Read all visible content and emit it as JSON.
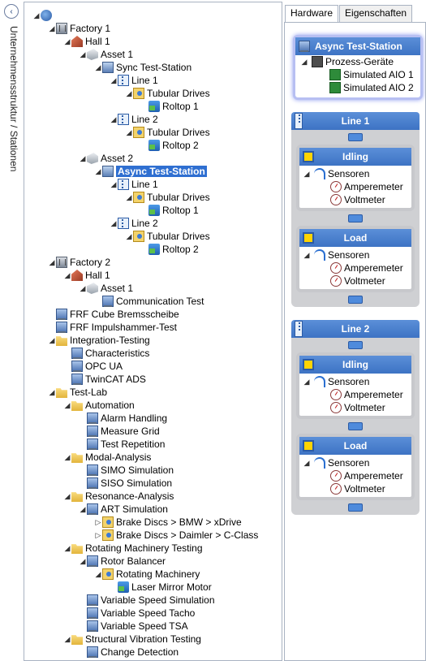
{
  "sidebar": {
    "label": "Unternehmensstruktur / Stationen",
    "collapse_icon": "chevron-left"
  },
  "tree": [
    {
      "depth": 0,
      "exp": "◢",
      "icon": "globe",
      "label": "",
      "name": "tree-root"
    },
    {
      "depth": 1,
      "exp": "◢",
      "icon": "factory",
      "label": "Factory 1"
    },
    {
      "depth": 2,
      "exp": "◢",
      "icon": "hall",
      "label": "Hall 1"
    },
    {
      "depth": 3,
      "exp": "◢",
      "icon": "asset",
      "label": "Asset 1"
    },
    {
      "depth": 4,
      "exp": "◢",
      "icon": "station",
      "label": "Sync Test-Station"
    },
    {
      "depth": 5,
      "exp": "◢",
      "icon": "line",
      "label": "Line 1"
    },
    {
      "depth": 6,
      "exp": "◢",
      "icon": "drives",
      "label": "Tubular Drives"
    },
    {
      "depth": 7,
      "exp": "",
      "icon": "roltop",
      "label": "Roltop 1"
    },
    {
      "depth": 5,
      "exp": "◢",
      "icon": "line",
      "label": "Line 2"
    },
    {
      "depth": 6,
      "exp": "◢",
      "icon": "drives",
      "label": "Tubular Drives"
    },
    {
      "depth": 7,
      "exp": "",
      "icon": "roltop",
      "label": "Roltop 2"
    },
    {
      "depth": 3,
      "exp": "◢",
      "icon": "asset",
      "label": "Asset 2"
    },
    {
      "depth": 4,
      "exp": "◢",
      "icon": "station",
      "label": "Async Test-Station",
      "selected": true
    },
    {
      "depth": 5,
      "exp": "◢",
      "icon": "line",
      "label": "Line 1"
    },
    {
      "depth": 6,
      "exp": "◢",
      "icon": "drives",
      "label": "Tubular Drives"
    },
    {
      "depth": 7,
      "exp": "",
      "icon": "roltop",
      "label": "Roltop 1"
    },
    {
      "depth": 5,
      "exp": "◢",
      "icon": "line",
      "label": "Line 2"
    },
    {
      "depth": 6,
      "exp": "◢",
      "icon": "drives",
      "label": "Tubular Drives"
    },
    {
      "depth": 7,
      "exp": "",
      "icon": "roltop",
      "label": "Roltop 2"
    },
    {
      "depth": 1,
      "exp": "◢",
      "icon": "factory",
      "label": "Factory 2"
    },
    {
      "depth": 2,
      "exp": "◢",
      "icon": "hall",
      "label": "Hall 1"
    },
    {
      "depth": 3,
      "exp": "◢",
      "icon": "asset",
      "label": "Asset 1"
    },
    {
      "depth": 4,
      "exp": "",
      "icon": "comp",
      "label": "Communication Test"
    },
    {
      "depth": 1,
      "exp": "",
      "icon": "comp",
      "label": "FRF Cube Bremsscheibe"
    },
    {
      "depth": 1,
      "exp": "",
      "icon": "comp",
      "label": "FRF Impulshammer-Test"
    },
    {
      "depth": 1,
      "exp": "◢",
      "icon": "folder",
      "label": "Integration-Testing"
    },
    {
      "depth": 2,
      "exp": "",
      "icon": "comp",
      "label": "Characteristics"
    },
    {
      "depth": 2,
      "exp": "",
      "icon": "comp",
      "label": "OPC UA"
    },
    {
      "depth": 2,
      "exp": "",
      "icon": "comp",
      "label": "TwinCAT ADS"
    },
    {
      "depth": 1,
      "exp": "◢",
      "icon": "folder",
      "label": "Test-Lab"
    },
    {
      "depth": 2,
      "exp": "◢",
      "icon": "folder",
      "label": "Automation"
    },
    {
      "depth": 3,
      "exp": "",
      "icon": "comp",
      "label": "Alarm Handling"
    },
    {
      "depth": 3,
      "exp": "",
      "icon": "comp",
      "label": "Measure Grid"
    },
    {
      "depth": 3,
      "exp": "",
      "icon": "comp",
      "label": "Test Repetition"
    },
    {
      "depth": 2,
      "exp": "◢",
      "icon": "folder",
      "label": "Modal-Analysis"
    },
    {
      "depth": 3,
      "exp": "",
      "icon": "comp",
      "label": "SIMO Simulation"
    },
    {
      "depth": 3,
      "exp": "",
      "icon": "comp",
      "label": "SISO Simulation"
    },
    {
      "depth": 2,
      "exp": "◢",
      "icon": "folder",
      "label": "Resonance-Analysis"
    },
    {
      "depth": 3,
      "exp": "◢",
      "icon": "comp",
      "label": "ART Simulation"
    },
    {
      "depth": 4,
      "exp": "▷",
      "icon": "drives",
      "label": "Brake Discs > BMW > xDrive"
    },
    {
      "depth": 4,
      "exp": "▷",
      "icon": "drives",
      "label": "Brake Discs > Daimler > C-Class"
    },
    {
      "depth": 2,
      "exp": "◢",
      "icon": "folder",
      "label": "Rotating Machinery Testing"
    },
    {
      "depth": 3,
      "exp": "◢",
      "icon": "comp",
      "label": "Rotor Balancer"
    },
    {
      "depth": 4,
      "exp": "◢",
      "icon": "drives",
      "label": "Rotating Machinery"
    },
    {
      "depth": 5,
      "exp": "",
      "icon": "roltop",
      "label": "Laser Mirror Motor"
    },
    {
      "depth": 3,
      "exp": "",
      "icon": "comp",
      "label": "Variable Speed Simulation"
    },
    {
      "depth": 3,
      "exp": "",
      "icon": "comp",
      "label": "Variable Speed Tacho"
    },
    {
      "depth": 3,
      "exp": "",
      "icon": "comp",
      "label": "Variable Speed TSA"
    },
    {
      "depth": 2,
      "exp": "◢",
      "icon": "folder",
      "label": "Structural Vibration Testing"
    },
    {
      "depth": 3,
      "exp": "",
      "icon": "comp",
      "label": "Change Detection"
    }
  ],
  "tabs": [
    {
      "label": "Hardware",
      "active": true
    },
    {
      "label": "Eigenschaften",
      "active": false
    }
  ],
  "station": {
    "title": "Async Test-Station",
    "group": "Prozess-Geräte",
    "devices": [
      "Simulated AIO 1",
      "Simulated AIO 2"
    ]
  },
  "lines": [
    {
      "title": "Line 1",
      "states": [
        {
          "title": "Idling",
          "sensor_group": "Sensoren",
          "sensors": [
            "Amperemeter",
            "Voltmeter"
          ]
        },
        {
          "title": "Load",
          "sensor_group": "Sensoren",
          "sensors": [
            "Amperemeter",
            "Voltmeter"
          ]
        }
      ]
    },
    {
      "title": "Line 2",
      "states": [
        {
          "title": "Idling",
          "sensor_group": "Sensoren",
          "sensors": [
            "Amperemeter",
            "Voltmeter"
          ]
        },
        {
          "title": "Load",
          "sensor_group": "Sensoren",
          "sensors": [
            "Amperemeter",
            "Voltmeter"
          ]
        }
      ]
    }
  ],
  "colors": {
    "header_blue": "#3d73c4",
    "selection": "#2f6fd1",
    "card_grey": "#cfd0d3"
  }
}
